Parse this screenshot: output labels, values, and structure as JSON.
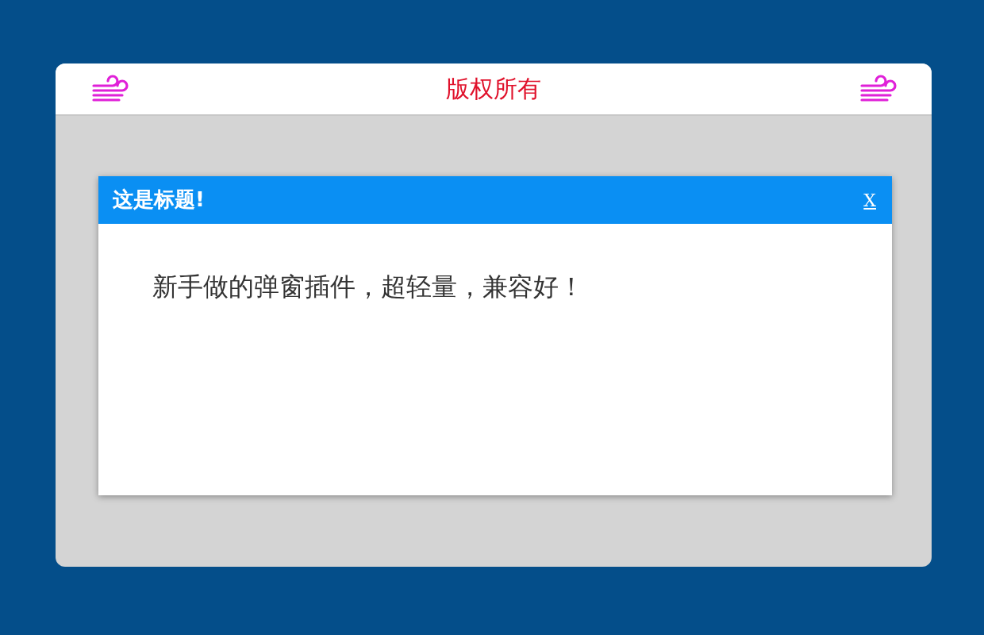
{
  "header": {
    "title": "版权所有"
  },
  "dialog": {
    "title": "这是标题!",
    "close": "X",
    "message": "新手做的弹窗插件，超轻量，兼容好！"
  }
}
